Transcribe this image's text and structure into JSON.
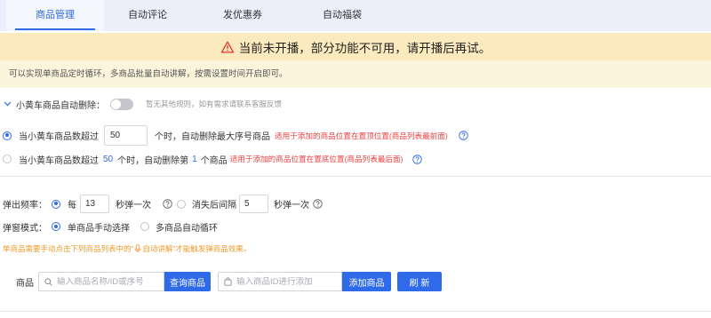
{
  "colors": {
    "primary": "#2f6ae8",
    "tab_bar_bg": "#eceffa",
    "warning_bg": "#fbeabd",
    "info_bg": "#fdf4dc",
    "danger": "#ee4040",
    "note_orange": "#ef9b2c",
    "warning_icon": "#e53935"
  },
  "tabs": [
    {
      "label": "商品管理",
      "active": true
    },
    {
      "label": "自动评论",
      "active": false
    },
    {
      "label": "发优惠券",
      "active": false
    },
    {
      "label": "自动福袋",
      "active": false
    }
  ],
  "warning_banner": {
    "icon": "warning-triangle-icon",
    "text": "当前未开播，部分功能不可用，请开播后再试。"
  },
  "info_banner": {
    "text": "可以实现单商品定时循环，多商品批量自动讲解，按需设置时间开启即可。"
  },
  "auto_delete": {
    "expand_icon": "chevron-down-icon",
    "label": "小黄车商品自动删除：",
    "enabled": false,
    "hint": "暂无其他规则，如有需求请联系客服反馈",
    "options": [
      {
        "selected": true,
        "prefix": "当小黄车商品数超过",
        "threshold": "50",
        "suffix": "个时，自动删除最大序号商品",
        "note": "适用于添加的商品位置在置顶位置(商品列表最前面)"
      },
      {
        "selected": false,
        "prefix": "当小黄车商品数超过",
        "threshold": "50",
        "middle": "个时，自动删除第",
        "position": "1",
        "suffix": "个商品",
        "note": "适用于添加的商品位置在置底位置(商品列表最后面)"
      }
    ]
  },
  "popup_frequency": {
    "label": "弹出频率：",
    "options": [
      {
        "selected": true,
        "prefix": "每",
        "value": "13",
        "suffix": "秒弹一次"
      },
      {
        "selected": false,
        "prefix": "消失后间隔",
        "value": "5",
        "suffix": "秒弹一次"
      }
    ]
  },
  "popup_mode": {
    "label": "弹窗模式：",
    "options": [
      {
        "selected": true,
        "label": "单商品手动选择"
      },
      {
        "selected": false,
        "label": "多商品自动循环"
      }
    ]
  },
  "mode_note": {
    "before": "单商品需要手动点击下列商品列表中的“",
    "icon": "microphone-icon",
    "highlight": "自动讲解",
    "after": "”才能触发弹商品效果。"
  },
  "product_search": {
    "label": "商品",
    "search_icon": "search-icon",
    "search_placeholder": "输入商品名称/ID或序号",
    "search_button": "查询商品",
    "add_icon": "shopping-bag-icon",
    "add_placeholder": "输入商品ID进行添加",
    "add_button": "添加商品",
    "refresh_button": "刷 新"
  }
}
